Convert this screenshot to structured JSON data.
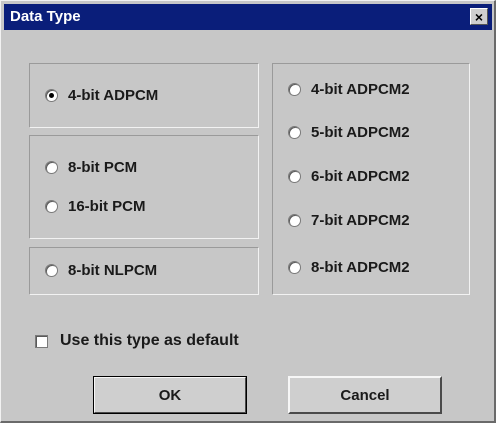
{
  "dialog": {
    "title": "Data Type",
    "close_glyph": "×"
  },
  "left_groups": {
    "adpcm": [
      {
        "label": "4-bit ADPCM",
        "selected": true
      }
    ],
    "pcm": [
      {
        "label": "8-bit PCM",
        "selected": false
      },
      {
        "label": "16-bit PCM",
        "selected": false
      }
    ],
    "nlpcm": [
      {
        "label": "8-bit NLPCM",
        "selected": false
      }
    ]
  },
  "right_group": [
    {
      "label": "4-bit ADPCM2",
      "selected": false
    },
    {
      "label": "5-bit ADPCM2",
      "selected": false
    },
    {
      "label": "6-bit ADPCM2",
      "selected": false
    },
    {
      "label": "7-bit ADPCM2",
      "selected": false
    },
    {
      "label": "8-bit ADPCM2",
      "selected": false
    }
  ],
  "default_checkbox": {
    "label": "Use this type as default",
    "checked": false
  },
  "buttons": {
    "ok": "OK",
    "cancel": "Cancel"
  }
}
